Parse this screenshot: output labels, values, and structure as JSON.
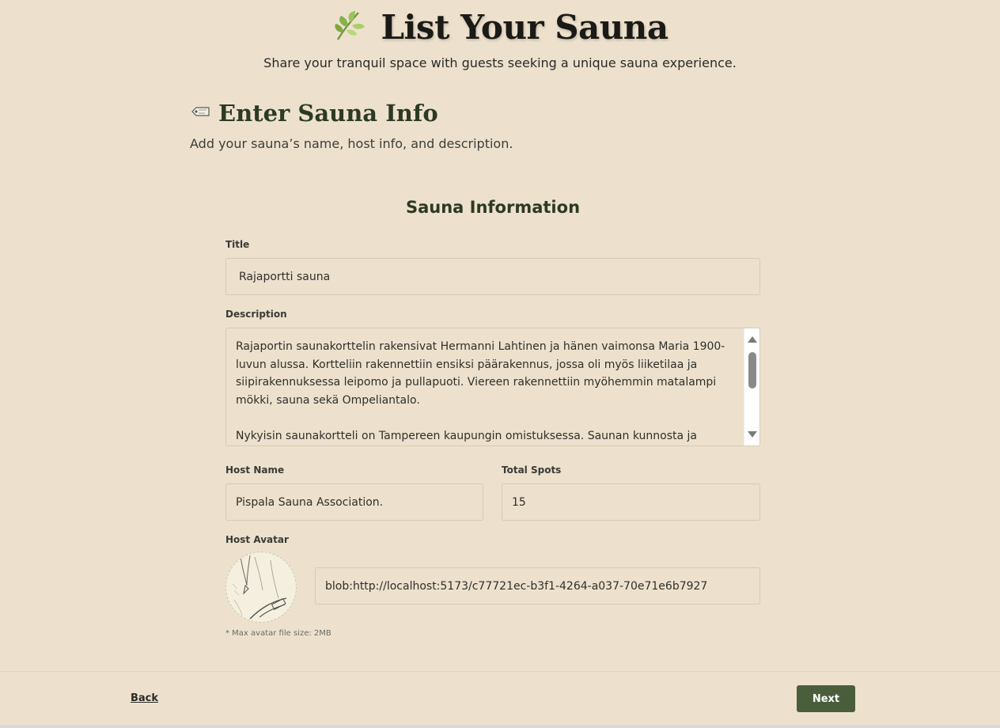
{
  "hero": {
    "icon": "leaf-icon",
    "title": "List Your Sauna",
    "subtitle": "Share your tranquil space with guests seeking a unique sauna experience."
  },
  "step": {
    "icon": "tag-icon",
    "title": "Enter Sauna Info",
    "subtitle": "Add your sauna’s name, host info, and description."
  },
  "form": {
    "section_title": "Sauna Information",
    "title_label": "Title",
    "title_value": "Rajaportti sauna",
    "description_label": "Description",
    "description_value": "Rajaportin saunakorttelin rakensivat Hermanni Lahtinen ja hänen vaimonsa Maria 1900-luvun alussa. Kortteliin rakennettiin ensiksi päärakennus, jossa oli myös liiketilaa ja siipirakennuksessa leipomo ja pullapuoti. Viereen rakennettiin myöhemmin matalampi mökki, sauna sekä Ompeliantalo.\n\nNykyisin saunakortteli on Tampereen kaupungin omistuksessa. Saunan kunnosta ja toiminnasta",
    "host_name_label": "Host Name",
    "host_name_value": "Pispala Sauna Association.",
    "total_spots_label": "Total Spots",
    "total_spots_value": "15",
    "host_avatar_label": "Host Avatar",
    "avatar_url_value": "blob:http://localhost:5173/c77721ec-b3f1-4264-a037-70e71e6b7927",
    "avatar_hint": "* Max avatar file size: 2MB"
  },
  "footer": {
    "back_label": "Back",
    "next_label": "Next"
  },
  "colors": {
    "background": "#ede1cd",
    "accent": "#4a5e3b",
    "heading": "#2c3a25"
  }
}
